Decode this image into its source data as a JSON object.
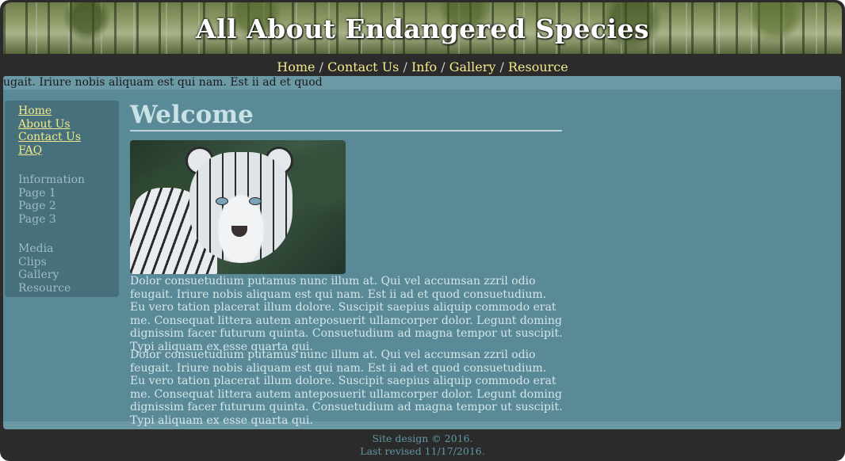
{
  "header": {
    "title": "All About Endangered Species"
  },
  "topnav": {
    "items": [
      "Home",
      "Contact Us",
      "Info",
      "Gallery",
      "Resource"
    ],
    "separator": " / "
  },
  "ticker": {
    "text": "ugait. Iriure nobis aliquam est qui nam. Est ii ad et quod"
  },
  "sidebar": {
    "group1": [
      "Home",
      "About Us",
      "Contact Us",
      "FAQ"
    ],
    "group2": [
      "Information",
      "Page 1",
      "Page 2",
      "Page 3"
    ],
    "group3": [
      "Media",
      "Clips",
      "Gallery",
      "Resource"
    ]
  },
  "main": {
    "heading": "Welcome",
    "image_alt": "White tiger",
    "paragraphs": [
      "Dolor consuetudium putamus nunc illum at. Qui vel accumsan zzril odio feugait. Iriure nobis aliquam est qui nam. Est ii ad et quod consuetudium. Eu vero tation placerat illum dolore. Suscipit saepius aliquip commodo erat me. Consequat littera autem anteposuerit ullamcorper dolor. Legunt doming dignissim facer futurum quinta. Consuetudium ad magna tempor ut suscipit. Typi aliquam ex esse quarta qui.",
      "Dolor consuetudium putamus nunc illum at. Qui vel accumsan zzril odio feugait. Iriure nobis aliquam est qui nam. Est ii ad et quod consuetudium. Eu vero tation placerat illum dolore. Suscipit saepius aliquip commodo erat me. Consequat littera autem anteposuerit ullamcorper dolor. Legunt doming dignissim facer futurum quinta. Consuetudium ad magna tempor ut suscipit. Typi aliquam ex esse quarta qui."
    ]
  },
  "footer": {
    "line1": "Site design © 2016.",
    "line2": "Last revised 11/17/2016."
  },
  "colors": {
    "frame": "#2b2b2b",
    "content": "#5a8a97",
    "sidebar": "#46707b",
    "link_active": "#f3e98a",
    "link_muted": "#9fbcc4"
  }
}
